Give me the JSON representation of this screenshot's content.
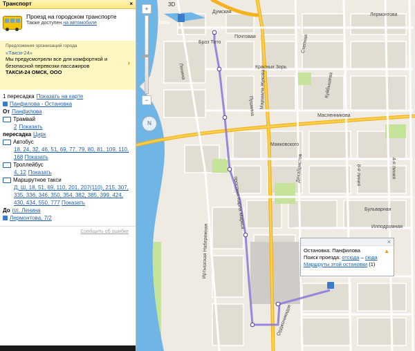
{
  "sidebar": {
    "header_title": "Транспорт",
    "close": "×",
    "transport_info": {
      "line1": "Проезд на городском транспорте",
      "line2_prefix": "Также доступен",
      "line2_link": "на автомобиле"
    },
    "ad": {
      "caption": "Предложения организаций города",
      "title": "«Такси-24»",
      "body": "Мы предусмотрели все для комфортной и безопасной перевозки пассажиров",
      "company": "ТАКСИ-24 ОМСК, ООО",
      "arrow": "›"
    },
    "route": {
      "transfers": "1 пересадка",
      "show_on_map": "Показать на карте",
      "start_stop": "Панфилова - Остановка",
      "from_label": "От",
      "from_value": "Панфилова",
      "tram_label": "Трамвай",
      "tram_num": "2",
      "tram_show": "Показать",
      "transfer_label": "пересадка",
      "transfer_value": "Цирк",
      "bus_label": "Автобус",
      "bus_nums": "18, 24, 32, 46, 51, 69, 77, 79, 80, 81, 109, 110, 168",
      "bus_show": "Показать",
      "trolley_label": "Троллейбус",
      "trolley_nums": "4, 12",
      "trolley_show": "Показать",
      "taxi_label": "Маршрутное такси",
      "taxi_nums": "Д, Ш, 18, 51, 69, 110, 201, 207(110), 215, 307, 335, 336, 346, 350, 354, 382, 385, 399, 424, 430, 434, 550, 777",
      "taxi_show": "Показать",
      "to_label": "До",
      "to_value": "пл. Ленина",
      "end_stop": "Лермонтова, 7/2"
    },
    "report_error": "Сообщить об ошибке"
  },
  "map": {
    "zoom_plus": "+",
    "zoom_minus": "−",
    "btn_3d": "3D",
    "compass": "N",
    "streets": {
      "dumskaya": "Думская",
      "pochtovaya": "Почтовая",
      "lermontova": "Лермонтова",
      "broz_tito": "Броз Тито",
      "lenina": "Ленина",
      "krasnyh_zor": "Красных Зорь",
      "maslennikova": "Масленникова",
      "mayakovskogo": "Маяковского",
      "pushkina": "Пушкина",
      "marshala_zhukova": "Маршала Жукова",
      "prospekt_karla_marksa": "проспект Карла Маркса",
      "irtyshskaya": "Иртышская Набережная",
      "ilyichevskaya": "Илподромная",
      "bulvarnaya": "Бульварная",
      "stepnaya": "Степная",
      "dekabristov": "Декабристов",
      "kuibysheva": "Куйбышева",
      "ordzhonikidze": "Орджоникидзе",
      "liniya4": "4-я линия",
      "liniya8": "8-я линия",
      "omsk": "ОМЬ"
    },
    "popup": {
      "title": "Остановка: Панфилова",
      "search_label": "Поиск проезда:",
      "from_link": "отсюда",
      "dash": "–",
      "to_link": "сюда",
      "routes_link": "Маршруты этой остановки",
      "routes_count": "(1)",
      "close": "×"
    }
  },
  "colors": {
    "route_line": "#8e7cdb",
    "river": "#6fb5e6",
    "main_road": "#f5b21f",
    "park": "#c6e39b",
    "block": "#e9e5dd",
    "link": "#1f5fa8"
  }
}
